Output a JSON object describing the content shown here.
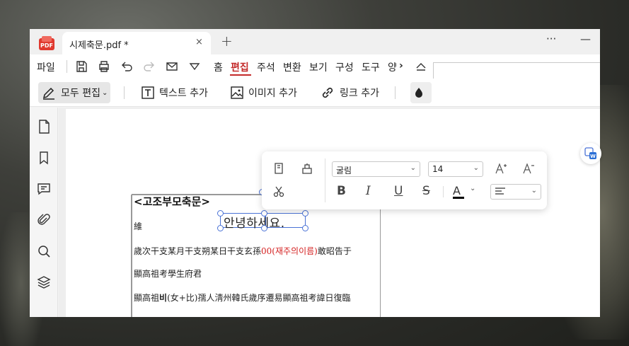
{
  "tab": {
    "title": "시제축문.pdf *",
    "close": "×",
    "new": "+"
  },
  "window_controls": {
    "more": "···",
    "minimize": "—"
  },
  "menu": {
    "file": "파일",
    "items": [
      "홈",
      "편집",
      "주석",
      "변환",
      "보기",
      "구성",
      "도구",
      "양"
    ],
    "active": "편집",
    "overflow": "›"
  },
  "toolbar": {
    "edit_all": "모두 편집",
    "add_text": "텍스트 추가",
    "add_image": "이미지 추가",
    "add_link": "링크 추가"
  },
  "document": {
    "heading": "<고조부모축문>",
    "line1": "維",
    "line2_a": "歲次干支某月干支朔某日干支玄孫",
    "line2_red": "00(재주의이름)",
    "line2_b": "敢昭告于",
    "line3": "顯高祖考學生府君",
    "line4_a": "顯高祖",
    "line4_b": "비",
    "line4_c": "(女+比)孺人淸州韓氏歲序遷易顯高祖考諱日復臨",
    "editing_text": "안녕하세요."
  },
  "format_toolbar": {
    "font": "굴림",
    "size": "14",
    "bold": "B",
    "italic": "I",
    "underline": "U",
    "strike": "S",
    "font_color": "A",
    "chevron": "⌄"
  },
  "colors": {
    "accent": "#c42b2b",
    "selection": "#4a72d6",
    "red_text": "#d42020"
  }
}
